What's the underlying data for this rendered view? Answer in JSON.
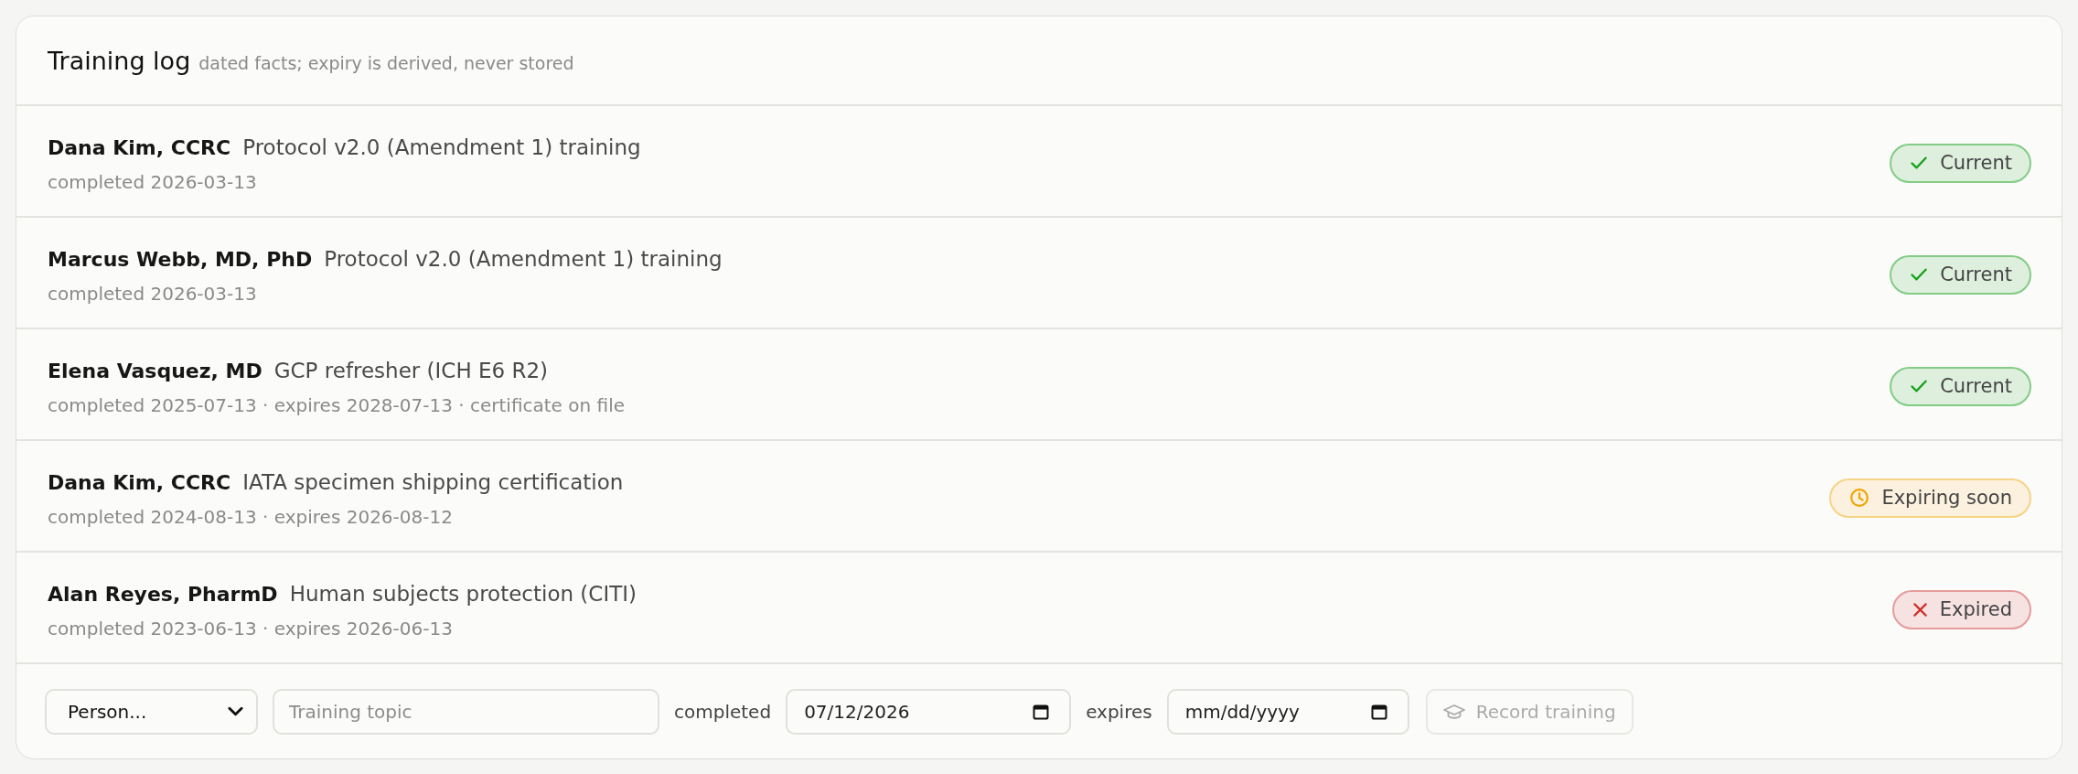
{
  "header": {
    "title": "Training log",
    "subtitle": "dated facts; expiry is derived, never stored"
  },
  "records": [
    {
      "person": "Dana Kim, CCRC",
      "topic": "Protocol v2.0 (Amendment 1) training",
      "details": "completed 2026-03-13",
      "status": {
        "kind": "current",
        "label": "Current"
      }
    },
    {
      "person": "Marcus Webb, MD, PhD",
      "topic": "Protocol v2.0 (Amendment 1) training",
      "details": "completed 2026-03-13",
      "status": {
        "kind": "current",
        "label": "Current"
      }
    },
    {
      "person": "Elena Vasquez, MD",
      "topic": "GCP refresher (ICH E6 R2)",
      "details": "completed 2025-07-13 · expires 2028-07-13 · certificate on file",
      "status": {
        "kind": "current",
        "label": "Current"
      }
    },
    {
      "person": "Dana Kim, CCRC",
      "topic": "IATA specimen shipping certification",
      "details": "completed 2024-08-13 · expires 2026-08-12",
      "status": {
        "kind": "expiring",
        "label": "Expiring soon"
      }
    },
    {
      "person": "Alan Reyes, PharmD",
      "topic": "Human subjects protection (CITI)",
      "details": "completed 2023-06-13 · expires 2026-06-13",
      "status": {
        "kind": "expired",
        "label": "Expired"
      }
    }
  ],
  "form": {
    "person_select": {
      "value": "Person..."
    },
    "topic_field": {
      "placeholder": "Training topic"
    },
    "completed_label": "completed",
    "completed_field": {
      "value": "07/12/2026"
    },
    "expires_label": "expires",
    "expires_field": {
      "placeholder": "mm/dd/yyyy"
    },
    "record_button": {
      "label": "Record training",
      "disabled": true
    }
  }
}
